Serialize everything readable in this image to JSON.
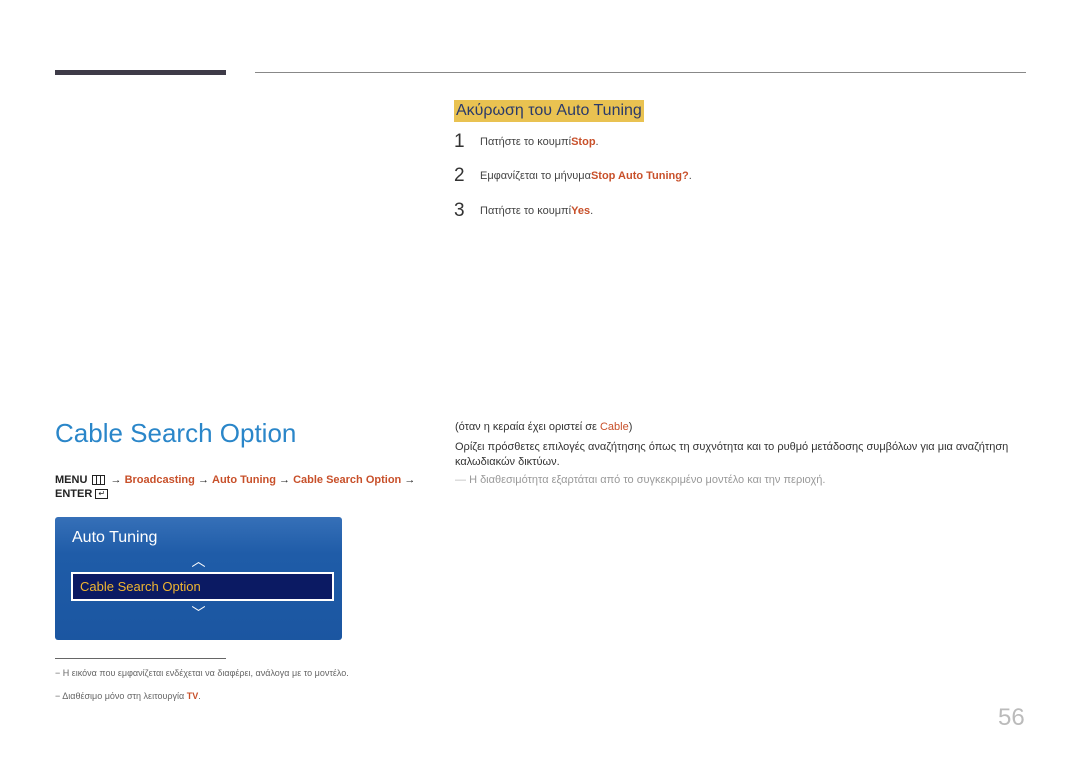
{
  "section": {
    "title": "Ακύρωση του Auto Tuning",
    "steps": [
      {
        "num": "1",
        "text": "Πατήστε το κουμπί ",
        "highlight": "Stop",
        "suffix": "."
      },
      {
        "num": "2",
        "text": "Εμφανίζεται το μήνυμα ",
        "highlight": "Stop Auto Tuning?",
        "suffix": "."
      },
      {
        "num": "3",
        "text": "Πατήστε το κουμπί ",
        "highlight": "Yes",
        "suffix": "."
      }
    ]
  },
  "page_title": "Cable Search Option",
  "path": {
    "menu": "MENU",
    "arrow": "→",
    "items": [
      "Broadcasting",
      "Auto Tuning",
      "Cable Search Option"
    ],
    "enter": "ENTER"
  },
  "osd": {
    "title": "Auto Tuning",
    "selected": "Cable Search Option",
    "up_icon": "chevron-up",
    "down_icon": "chevron-down"
  },
  "condition": {
    "text": "(όταν η κεραία έχει οριστεί σε ",
    "highlight": "Cable",
    "suffix": ")"
  },
  "description": "Ορίζει πρόσθετες επιλογές αναζήτησης όπως τη συχνότητα και το ρυθμό μετάδοσης συμβόλων για μια αναζήτηση καλωδιακών δικτύων.",
  "note": "Η διαθεσιμότητα εξαρτάται από το συγκεκριμένο μοντέλο και την περιοχή.",
  "footnotes": [
    {
      "text": "Η εικόνα που εμφανίζεται ενδέχεται να διαφέρει, ανάλογα με το μοντέλο.",
      "highlight": ""
    },
    {
      "text": "Διαθέσιμο μόνο στη λειτουργία ",
      "highlight": "TV",
      "suffix": "."
    }
  ],
  "page_number": "56"
}
